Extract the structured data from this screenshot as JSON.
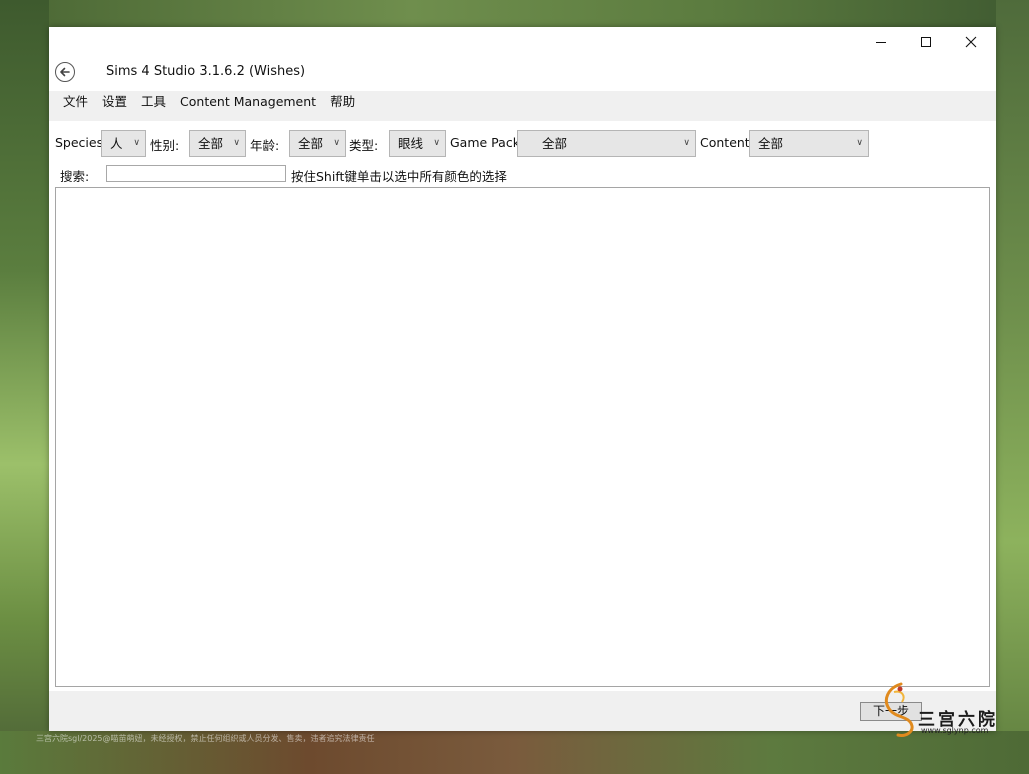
{
  "window": {
    "title": "Sims 4 Studio 3.1.6.2 (Wishes)"
  },
  "menu": {
    "items": [
      "文件",
      "设置",
      "工具",
      "Content Management",
      "帮助"
    ]
  },
  "filters": {
    "species_label": "Species",
    "species_value": "人",
    "gender_label": "性别:",
    "gender_value": "全部",
    "age_label": "年龄:",
    "age_value": "全部",
    "type_label": "类型:",
    "type_value": "眼线",
    "gamepack_label": "Game Pack",
    "gamepack_value": "全部",
    "content_label": "Content",
    "content_value": "全部"
  },
  "search": {
    "label": "搜索:",
    "value": "",
    "hint": "按住Shift键单击以选中所有颜色的选择"
  },
  "footer": {
    "next_label": "下一步"
  },
  "watermark": {
    "bottom_left": "三宫六院sgl/2025@喵苗萌妞，未经授权，禁止任何组织或人员分发、售卖，违者追究法律责任",
    "brand": "三宫六院",
    "url": "www.sglynp.com"
  },
  "icons": {
    "back": "back-arrow-icon",
    "minimize": "minimize-icon",
    "maximize": "maximize-icon",
    "close": "close-icon",
    "chevron": "chevron-down-icon"
  }
}
